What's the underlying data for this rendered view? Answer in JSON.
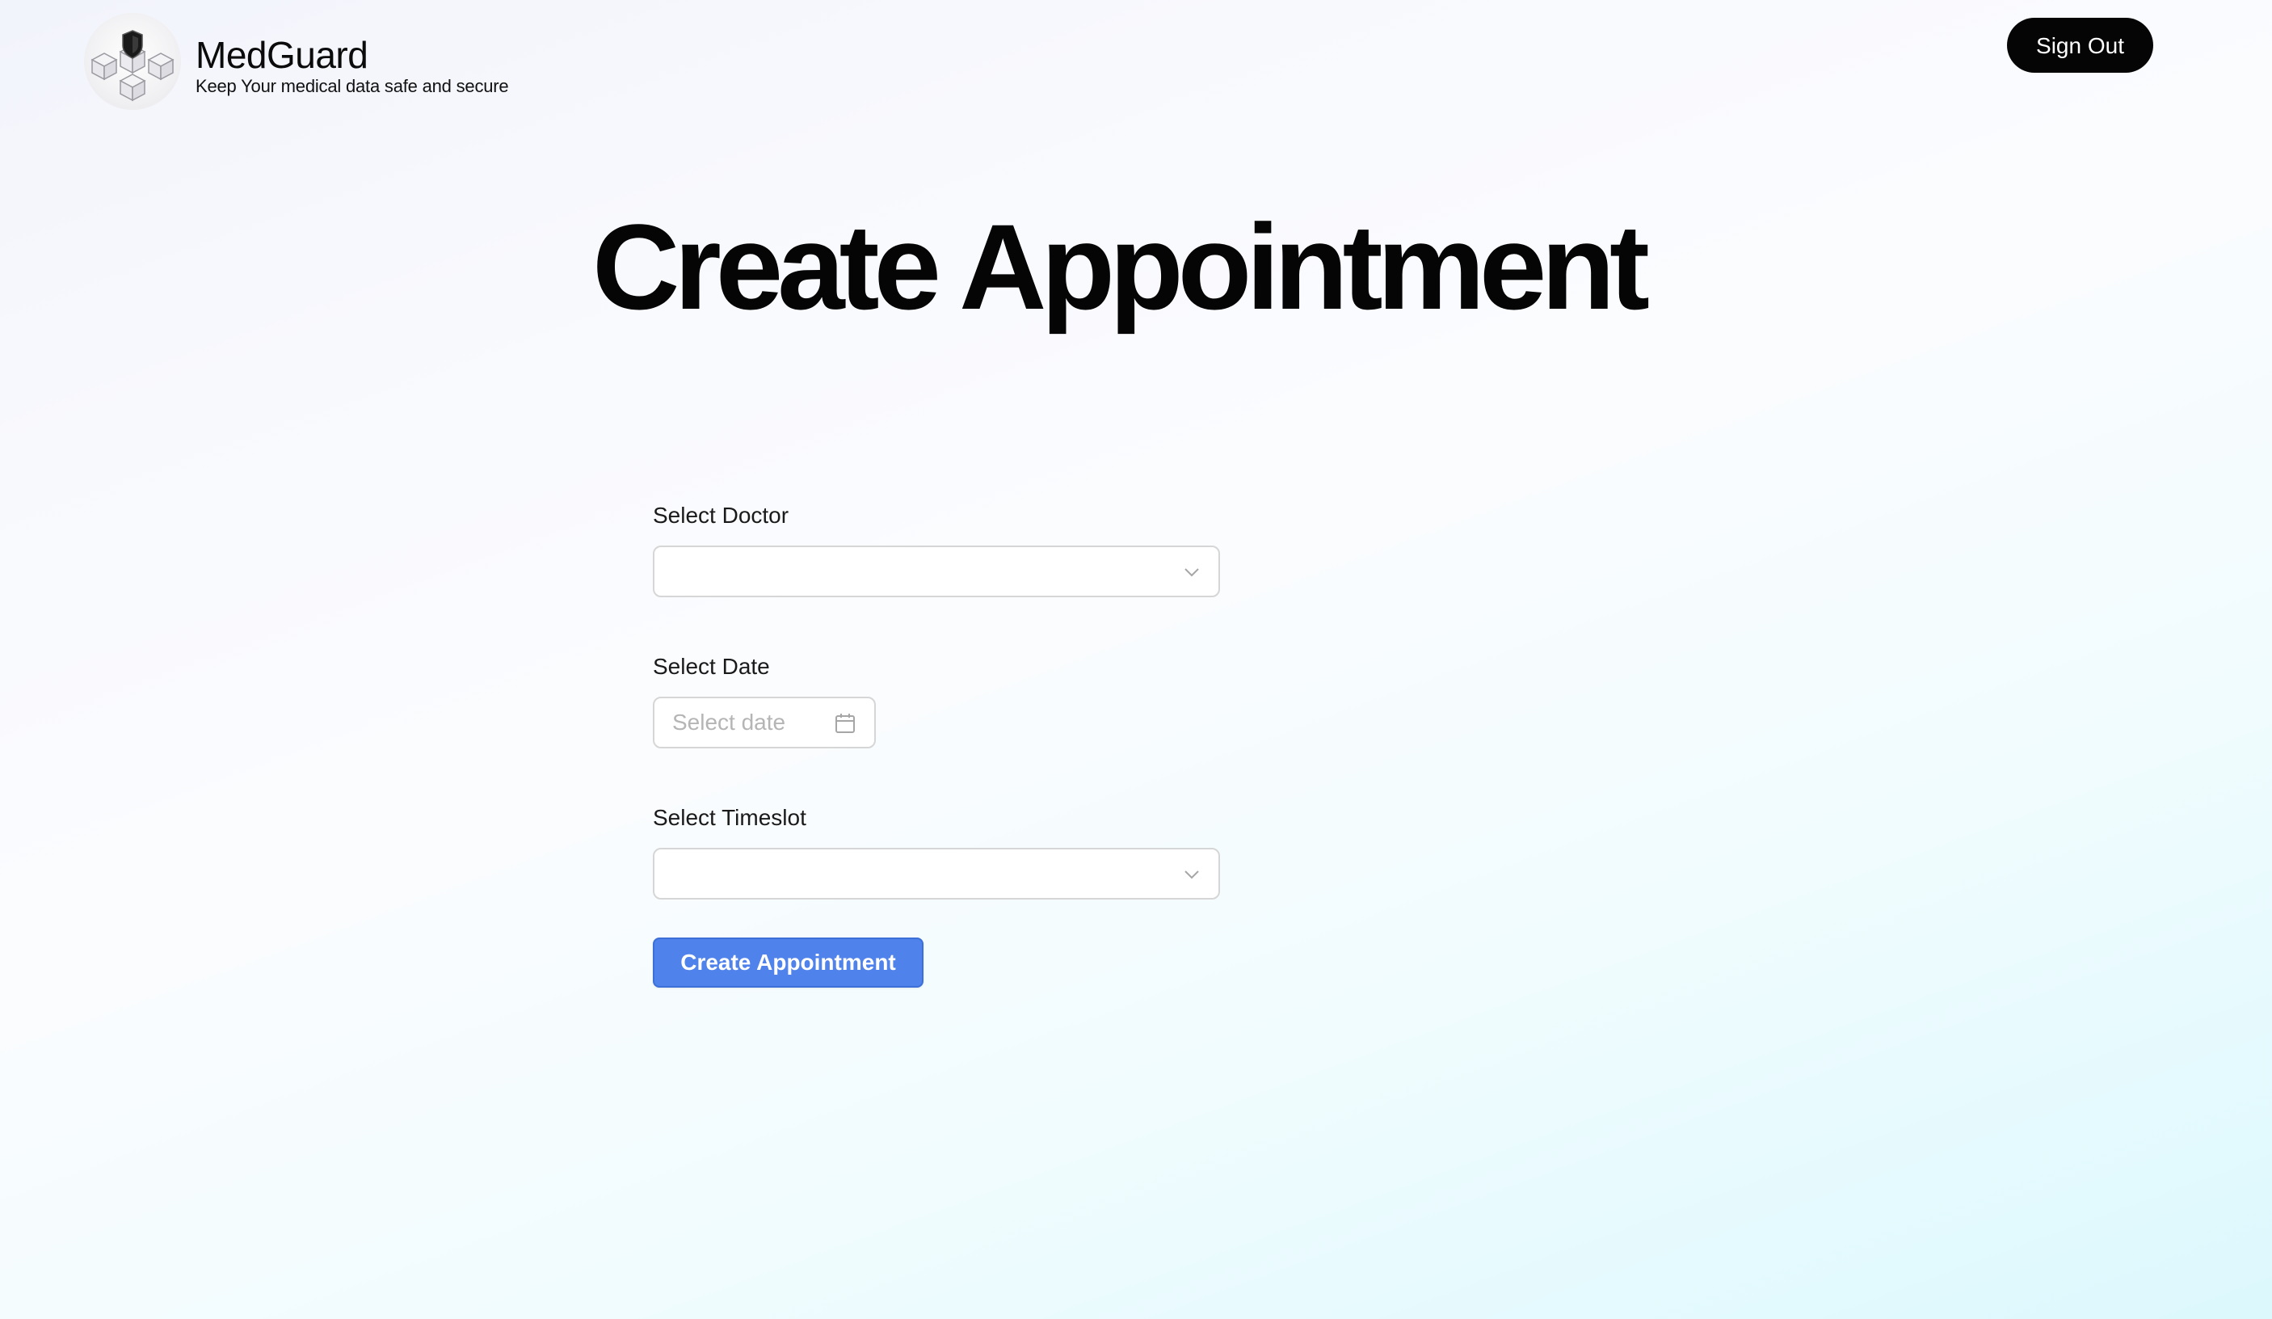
{
  "header": {
    "brand_name": "MedGuard",
    "tagline": "Keep Your medical data safe and secure",
    "logo_icon": "shield-cubes-logo",
    "signout_label": "Sign Out"
  },
  "page": {
    "title": "Create Appointment"
  },
  "form": {
    "doctor": {
      "label": "Select Doctor",
      "value": ""
    },
    "date": {
      "label": "Select Date",
      "placeholder": "Select date",
      "icon": "calendar-icon"
    },
    "timeslot": {
      "label": "Select Timeslot",
      "value": ""
    },
    "submit_label": "Create Appointment"
  },
  "colors": {
    "primary_button": "#4f82ea",
    "signout_button": "#050505"
  }
}
